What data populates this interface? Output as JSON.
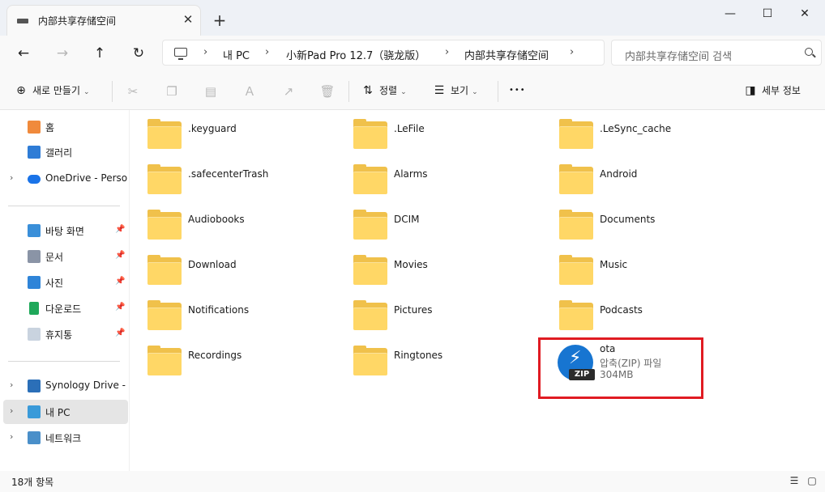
{
  "tab": {
    "title": "内部共享存储空间",
    "close": "✕",
    "new_tab": "+"
  },
  "window": {
    "minimize": "—",
    "maximize": "☐",
    "close": "✕"
  },
  "nav": {
    "back": "←",
    "forward": "→",
    "up": "↑",
    "refresh": "↻"
  },
  "breadcrumb": {
    "items": [
      "내 PC",
      "小新Pad Pro 12.7（骁龙版）",
      "内部共享存储空间"
    ],
    "separator": "›"
  },
  "search": {
    "placeholder": "内部共享存储空间 검색"
  },
  "toolbar": {
    "new_label": "새로 만들기",
    "sort_label": "정렬",
    "view_label": "보기",
    "more": "•••",
    "details_label": "세부 정보",
    "caret": "⌄"
  },
  "sidebar": {
    "top": [
      {
        "label": "홈",
        "icon": "home-icon"
      },
      {
        "label": "갤러리",
        "icon": "gallery-icon"
      },
      {
        "label": "OneDrive - Personal",
        "icon": "onedrive-icon"
      }
    ],
    "quick": [
      {
        "label": "바탕 화면",
        "icon": "desktop-icon"
      },
      {
        "label": "문서",
        "icon": "documents-icon"
      },
      {
        "label": "사진",
        "icon": "pictures-icon"
      },
      {
        "label": "다운로드",
        "icon": "download-icon"
      },
      {
        "label": "휴지통",
        "icon": "recycle-bin-icon"
      }
    ],
    "bottom": [
      {
        "label": "Synology Drive - D",
        "icon": "synology-drive-icon"
      },
      {
        "label": "내 PC",
        "icon": "this-pc-icon"
      },
      {
        "label": "네트워크",
        "icon": "network-icon"
      }
    ]
  },
  "files": [
    ".keyguard",
    ".LeFile",
    ".LeSync_cache",
    ".safecenterTrash",
    "Alarms",
    "Android",
    "Audiobooks",
    "DCIM",
    "Documents",
    "Download",
    "Movies",
    "Music",
    "Notifications",
    "Pictures",
    "Podcasts",
    "Recordings",
    "Ringtones"
  ],
  "zip_file": {
    "name": "ota",
    "type": "압축(ZIP) 파일",
    "size": "304MB",
    "badge": "ZIP"
  },
  "status": {
    "count": "18개 항목"
  },
  "colors": {
    "accent": "#1775d1",
    "highlight": "#e01b22",
    "folder": "#ffd766"
  }
}
